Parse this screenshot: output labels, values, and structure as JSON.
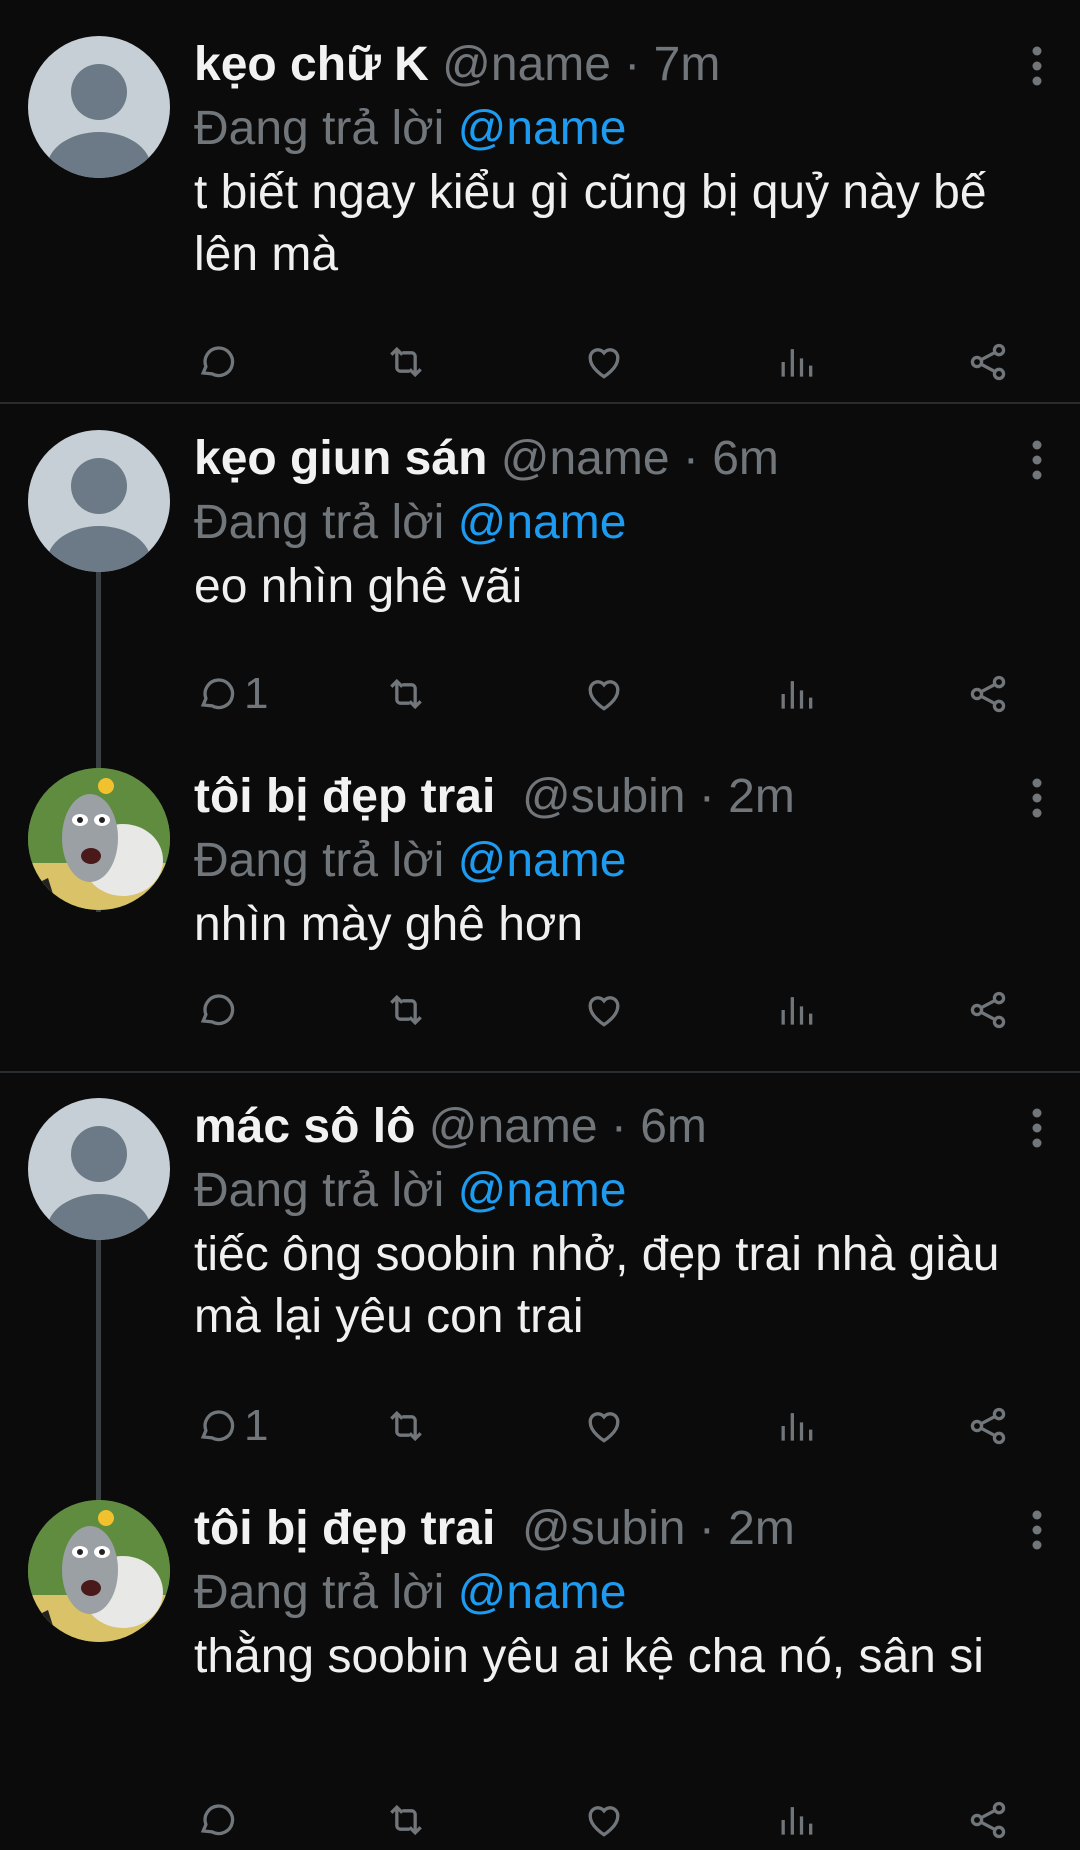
{
  "tweets": [
    {
      "name": "kẹo chữ K",
      "handle": "@name",
      "time": "7m",
      "sep": " · ",
      "replying": "Đang trả lời",
      "mention": "@name",
      "text": "t biết ngay kiểu gì cũng bị quỷ này bế lên mà",
      "reply_count": ""
    },
    {
      "name": "kẹo giun sán",
      "handle": "@name",
      "time": "6m",
      "sep": " · ",
      "replying": "Đang trả lời",
      "mention": "@name",
      "text": "eo nhìn ghê vãi",
      "reply_count": "1"
    },
    {
      "name": "tôi bị đẹp trai",
      "handle": "@subin",
      "time": "2m",
      "sep": " · ",
      "replying": "Đang trả lời",
      "mention": "@name",
      "text": "nhìn mày ghê hơn",
      "reply_count": ""
    },
    {
      "name": "mác sô lô",
      "handle": "@name",
      "time": "6m",
      "sep": " · ",
      "replying": "Đang trả lời",
      "mention": "@name",
      "text": "tiếc ông soobin nhở, đẹp trai nhà giàu mà lại yêu con trai",
      "reply_count": "1"
    },
    {
      "name": "tôi bị đẹp trai",
      "handle": "@subin",
      "time": "2m",
      "sep": " · ",
      "replying": "Đang trả lời",
      "mention": "@name",
      "text": "thằng soobin yêu ai kệ cha nó, sân si",
      "reply_count": ""
    }
  ],
  "icons": {
    "reply": "reply-icon",
    "retweet": "retweet-icon",
    "like": "heart-icon",
    "views": "views-icon",
    "share": "share-icon",
    "more": "more-icon"
  }
}
